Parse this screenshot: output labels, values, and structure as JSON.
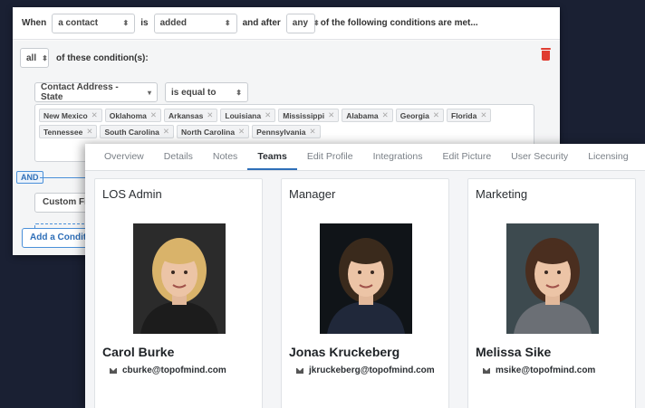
{
  "conditions": {
    "trigger": {
      "when_label": "When",
      "subject_value": "a contact",
      "is_label": "is",
      "action_value": "added",
      "after_label": "and after",
      "quantifier_value": "any",
      "suffix_label": "of the following conditions are met..."
    },
    "group": {
      "mode_value": "all",
      "mode_label": "of these condition(s):",
      "field_value": "Contact Address - State",
      "operator_value": "is equal to",
      "states": [
        "New Mexico",
        "Oklahoma",
        "Arkansas",
        "Louisiana",
        "Mississippi",
        "Alabama",
        "Georgia",
        "Florida",
        "Tennessee",
        "South Carolina",
        "North Carolina",
        "Pennsylvania"
      ]
    },
    "and_label": "AND",
    "custom_field_value": "Custom Fie",
    "add_condition_label": "Add a Conditi",
    "accent_color": "#2f6fb8",
    "delete_color": "#e03c31"
  },
  "profile": {
    "tabs": [
      {
        "label": "Overview",
        "active": false
      },
      {
        "label": "Details",
        "active": false
      },
      {
        "label": "Notes",
        "active": false
      },
      {
        "label": "Teams",
        "active": true
      },
      {
        "label": "Edit Profile",
        "active": false
      },
      {
        "label": "Integrations",
        "active": false
      },
      {
        "label": "Edit Picture",
        "active": false
      },
      {
        "label": "User Security",
        "active": false
      },
      {
        "label": "Licensing",
        "active": false
      }
    ],
    "teams": [
      {
        "title": "LOS Admin",
        "name": "Carol Burke",
        "email": "cburke@topofmind.com",
        "hair": "#d9b36a",
        "attire": "#1c1c1c",
        "backdrop": "#2b2b2b"
      },
      {
        "title": "Manager",
        "name": "Jonas Kruckeberg",
        "email": "jkruckeberg@topofmind.com",
        "hair": "#3a2a1c",
        "attire": "#20283a",
        "backdrop": "#101418"
      },
      {
        "title": "Marketing",
        "name": "Melissa Sike",
        "email": "msike@topofmind.com",
        "hair": "#4a2e1f",
        "attire": "#6b6f75",
        "backdrop": "#3d4a4f"
      }
    ]
  }
}
